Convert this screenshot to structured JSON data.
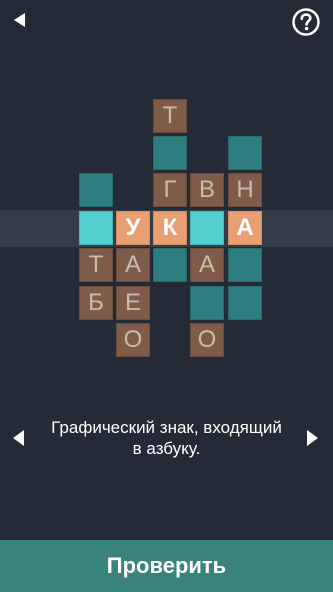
{
  "clue": {
    "line1": "Графический знак, входящий",
    "line2": "в азбуку."
  },
  "check_button": {
    "label": "Проверить"
  },
  "grid": {
    "t": "Т",
    "g": "Г",
    "v": "В",
    "n": "Н",
    "row_active_u": "У",
    "row_active_k": "К",
    "row_active_a": "А",
    "r3_t": "Т",
    "r3_a1": "А",
    "r3_a2": "А",
    "r4_b": "Б",
    "r4_e": "Е",
    "r5_o1": "О",
    "r5_o2": "О"
  },
  "colors": {
    "background": "#242a36",
    "brown_cell": "#7f5b49",
    "teal_cell": "#2e7e7f",
    "cyan_cell": "#54cfcf",
    "orange_cell": "#e89f72",
    "check_button": "#3a837a"
  },
  "icons": {
    "back": "back-arrow-icon",
    "help": "help-circle-icon",
    "prev": "previous-arrow-icon",
    "next": "next-arrow-icon"
  }
}
